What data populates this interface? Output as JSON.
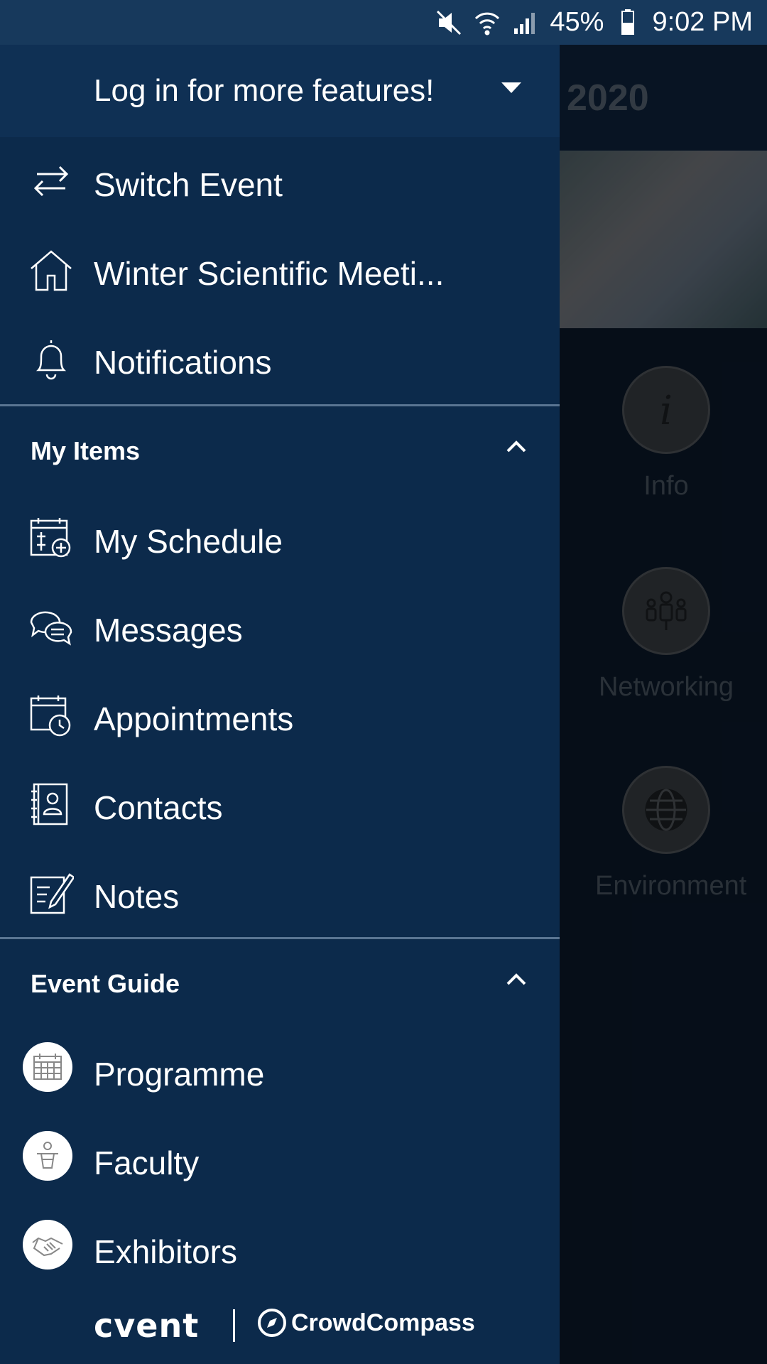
{
  "status_bar": {
    "battery": "45%",
    "time": "9:02 PM"
  },
  "background_app": {
    "title_fragment": "2020",
    "tiles": [
      {
        "label": "Info",
        "icon": "info-icon"
      },
      {
        "label": "Networking",
        "icon": "people-icon"
      },
      {
        "label": "Environment",
        "icon": "globe-icon"
      }
    ]
  },
  "drawer": {
    "login_prompt": "Log in for more features!",
    "top_items": [
      {
        "label": "Switch Event",
        "icon": "switch-arrows-icon"
      },
      {
        "label": "Winter Scientific Meeti...",
        "icon": "home-icon"
      },
      {
        "label": "Notifications",
        "icon": "bell-icon"
      }
    ],
    "my_items": {
      "title": "My Items",
      "items": [
        {
          "label": "My Schedule",
          "icon": "calendar-plus-icon"
        },
        {
          "label": "Messages",
          "icon": "chat-bubbles-icon"
        },
        {
          "label": "Appointments",
          "icon": "calendar-clock-icon"
        },
        {
          "label": "Contacts",
          "icon": "contact-book-icon"
        },
        {
          "label": "Notes",
          "icon": "note-edit-icon"
        }
      ]
    },
    "event_guide": {
      "title": "Event Guide",
      "items": [
        {
          "label": "Programme",
          "icon": "calendar-grid-icon"
        },
        {
          "label": "Faculty",
          "icon": "speaker-podium-icon"
        },
        {
          "label": "Exhibitors",
          "icon": "handshake-icon"
        }
      ]
    },
    "footer": {
      "brand1": "cvent",
      "brand2": "CrowdCompass"
    }
  }
}
